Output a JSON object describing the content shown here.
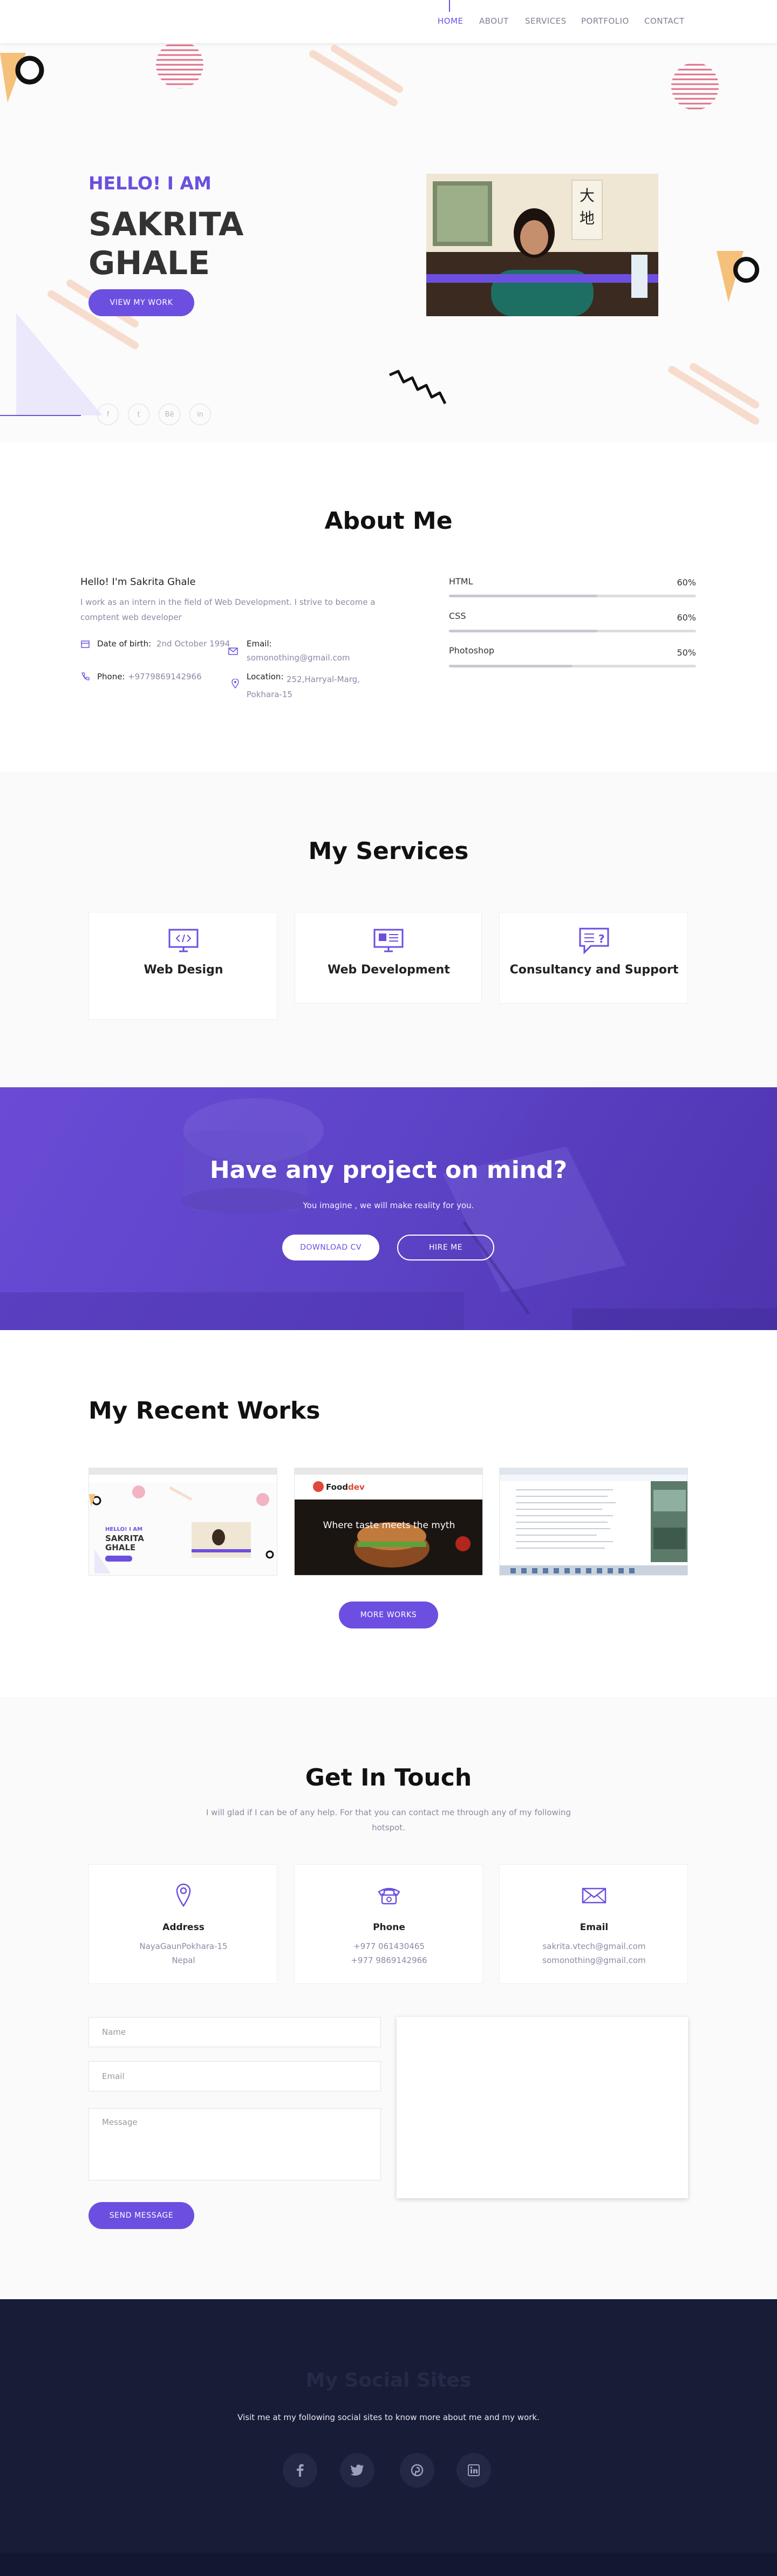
{
  "nav": {
    "items": [
      "HOME",
      "ABOUT",
      "SERVICES",
      "PORTFOLIO",
      "CONTACT"
    ]
  },
  "hero": {
    "greeting": "HELLO! I AM",
    "name_line1": "SAKRITA",
    "name_line2": "GHALE",
    "cta": "VIEW MY WORK",
    "social": [
      "f",
      "t",
      "Bē",
      "in"
    ]
  },
  "about": {
    "title": "About Me",
    "heading": "Hello! I'm Sakrita Ghale",
    "intro": "I work as an intern in the field of Web Development. I strive to become a comptent web developer",
    "dob_label": "Date of birth:",
    "dob_value": "2nd October 1994",
    "email_label": "Email:",
    "email_value": "somonothing@gmail.com",
    "phone_label": "Phone:",
    "phone_value": "+9779869142966",
    "location_label": "Location:",
    "location_value": "252,Harryal-Marg, Pokhara-15",
    "skills": [
      {
        "name": "HTML",
        "percent": "60%",
        "level": 0.6
      },
      {
        "name": "CSS",
        "percent": "60%",
        "level": 0.6
      },
      {
        "name": "Photoshop",
        "percent": "50%",
        "level": 0.5
      }
    ]
  },
  "services": {
    "title": "My Services",
    "items": [
      "Web Design",
      "Web Development",
      "Consultancy and Support"
    ]
  },
  "project": {
    "title": "Have any project on mind?",
    "subtitle": "You imagine , we will make reality for you.",
    "download": "DOWNLOAD CV",
    "hire": "HIRE ME"
  },
  "works": {
    "title": "My Recent Works",
    "more": "MORE WORKS",
    "thumb1_greeting": "HELLO! I AM",
    "thumb1_name": "SAKRITA GHALE",
    "thumb2_brand": "Food",
    "thumb2_brand_accent": "dev",
    "thumb2_tagline": "Where taste meets the myth"
  },
  "contact": {
    "title": "Get In Touch",
    "intro": "I will glad if I can be of any help. For that you can contact me through any of my following hotspot.",
    "cards": [
      {
        "label": "Address",
        "line1": "NayaGaunPokhara-15",
        "line2": "Nepal"
      },
      {
        "label": "Phone",
        "line1": "+977 061430465",
        "line2": "+977 9869142966"
      },
      {
        "label": "Email",
        "line1": "sakrita.vtech@gmail.com",
        "line2": "somonothing@gmail.com"
      }
    ],
    "name_placeholder": "Name",
    "email_placeholder": "Email",
    "message_placeholder": "Message",
    "send": "SEND MESSAGE"
  },
  "footer": {
    "title": "My Social Sites",
    "text": "Visit me at my following social sites to know more about me and my work."
  },
  "colors": {
    "accent": "#6c4fe0",
    "footer_bg": "#171c37",
    "pink": "#e0708a"
  }
}
